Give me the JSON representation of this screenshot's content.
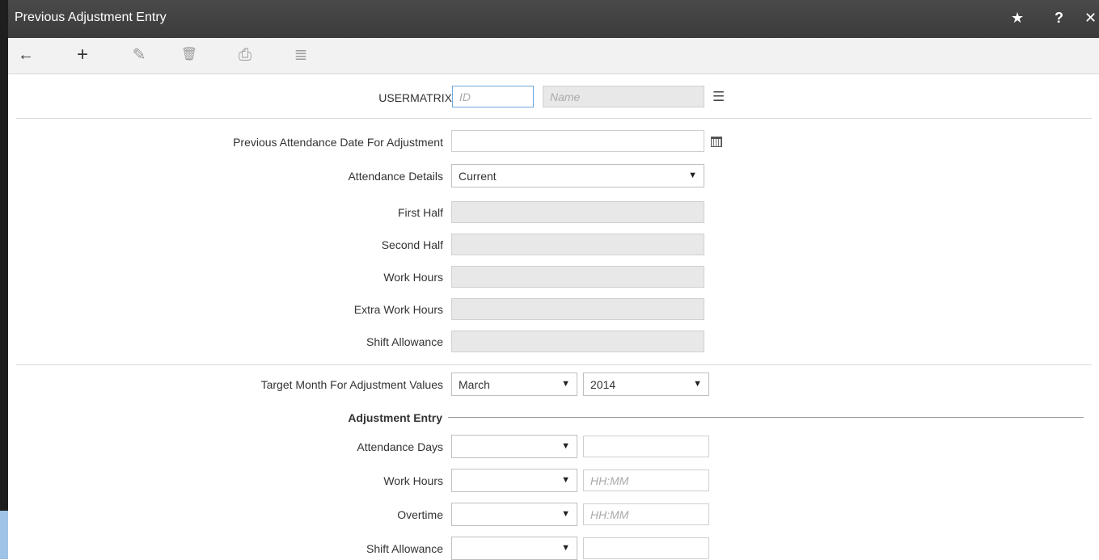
{
  "window": {
    "title": "Previous Adjustment Entry",
    "actions": {
      "favorite": "★",
      "help": "?",
      "close": "✕"
    }
  },
  "toolbar": {
    "back": "←",
    "add": "+",
    "edit": "✎",
    "delete": "🗑",
    "save": "⎙",
    "clear": "≣"
  },
  "usermatrix": {
    "label": "USERMATRIX",
    "id_placeholder": "ID",
    "name_placeholder": "Name"
  },
  "attendance": {
    "date_label": "Previous Attendance Date For Adjustment",
    "details_label": "Attendance Details",
    "details_value": "Current",
    "first_half_label": "First Half",
    "second_half_label": "Second Half",
    "work_hours_label": "Work Hours",
    "extra_work_hours_label": "Extra Work Hours",
    "shift_allowance_label": "Shift Allowance"
  },
  "target": {
    "label": "Target Month For Adjustment Values",
    "month": "March",
    "year": "2014"
  },
  "adjustment": {
    "section_title": "Adjustment Entry",
    "attendance_days_label": "Attendance Days",
    "work_hours_label": "Work Hours",
    "work_hours_placeholder": "HH:MM",
    "overtime_label": "Overtime",
    "overtime_placeholder": "HH:MM",
    "shift_allowance_label": "Shift Allowance"
  },
  "colors": {
    "titlebar": "#3f3f3f",
    "toolbar": "#f2f2f2",
    "focus_border": "#6ea7e0",
    "readonly_bg": "#e8e8e8"
  }
}
